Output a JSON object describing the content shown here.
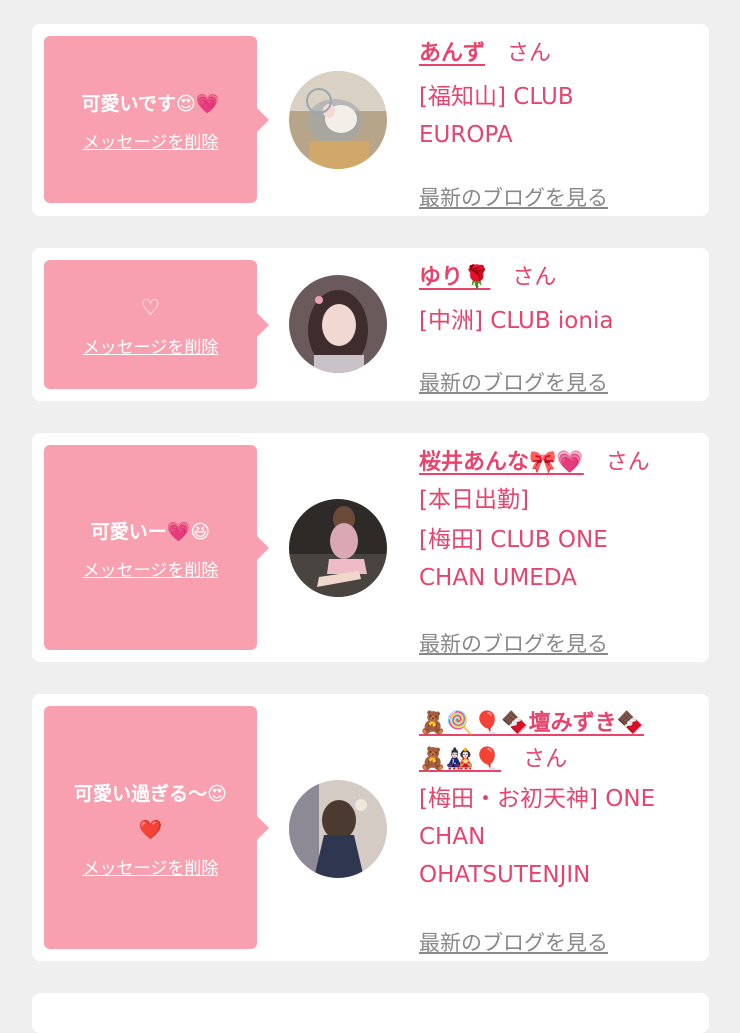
{
  "cards": [
    {
      "message": "可愛いです😍💗",
      "delete_label": "メッセージを削除",
      "name": "あんず",
      "honorific": "さん",
      "store_lines": [
        "[福知山] CLUB",
        "EUROPA"
      ],
      "blog_link": "最新のブログを見る"
    },
    {
      "message": "♡",
      "delete_label": "メッセージを削除",
      "name": "ゆり🌹",
      "honorific": "さん",
      "store_lines": [
        "[中洲] CLUB ionia"
      ],
      "blog_link": "最新のブログを見る"
    },
    {
      "message": "可愛いー💗😆",
      "delete_label": "メッセージを削除",
      "name": "桜井あんな🎀💗",
      "honorific": "さん",
      "status": "[本日出勤]",
      "store_lines": [
        "[梅田] CLUB ONE",
        "CHAN UMEDA"
      ],
      "blog_link": "最新のブログを見る"
    },
    {
      "message_lines": [
        "可愛い過ぎる〜😍",
        "❤️"
      ],
      "delete_label": "メッセージを削除",
      "name_line1": "🧸🍭🎈🍫壇みずき🍫",
      "name_line2": "🧸🎎🎈",
      "honorific": "さん",
      "store_lines": [
        "[梅田・お初天神] ONE",
        "CHAN",
        "OHATSUTENJIN"
      ],
      "blog_link": "最新のブログを見る"
    }
  ]
}
